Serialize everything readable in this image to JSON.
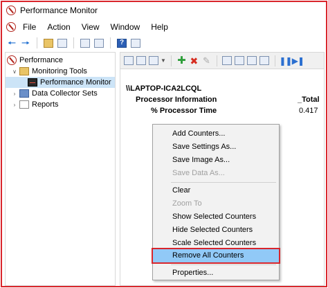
{
  "window": {
    "title": "Performance Monitor"
  },
  "menu": [
    "File",
    "Action",
    "View",
    "Window",
    "Help"
  ],
  "tree": {
    "root": "Performance",
    "items": [
      {
        "label": "Monitoring Tools",
        "expanded": true
      },
      {
        "label": "Performance Monitor",
        "selected": true
      },
      {
        "label": "Data Collector Sets"
      },
      {
        "label": "Reports"
      }
    ]
  },
  "report": {
    "host": "\\\\LAPTOP-ICA2LCQL",
    "object": "Processor Information",
    "instance": "_Total",
    "counter": "% Processor Time",
    "value": "0.417"
  },
  "context_menu": {
    "items": [
      {
        "label": "Add Counters..."
      },
      {
        "label": "Save Settings As..."
      },
      {
        "label": "Save Image As..."
      },
      {
        "label": "Save Data As...",
        "disabled": true
      },
      {
        "label": "Clear"
      },
      {
        "label": "Zoom To",
        "disabled": true
      },
      {
        "label": "Show Selected Counters"
      },
      {
        "label": "Hide Selected Counters"
      },
      {
        "label": "Scale Selected Counters"
      },
      {
        "label": "Remove All Counters",
        "highlighted": true
      },
      {
        "label": "Properties..."
      }
    ]
  },
  "colors": {
    "highlight_border": "#d9252b",
    "menu_highlight": "#91c9f7",
    "tree_selected": "#cce4f7"
  }
}
